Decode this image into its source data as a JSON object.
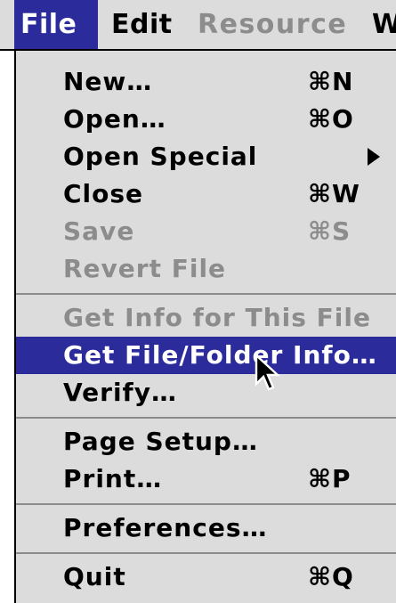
{
  "menubar": {
    "items": [
      {
        "label": "File",
        "state": "active"
      },
      {
        "label": "Edit",
        "state": "enabled"
      },
      {
        "label": "Resource",
        "state": "disabled"
      },
      {
        "label": "W",
        "state": "enabled"
      }
    ]
  },
  "file_menu": {
    "items": [
      {
        "label": "New…",
        "shortcut": "⌘N",
        "state": "enabled"
      },
      {
        "label": "Open…",
        "shortcut": "⌘O",
        "state": "enabled"
      },
      {
        "label": "Open Special",
        "shortcut": "",
        "submenu": true,
        "state": "enabled"
      },
      {
        "label": "Close",
        "shortcut": "⌘W",
        "state": "enabled"
      },
      {
        "label": "Save",
        "shortcut": "⌘S",
        "state": "disabled"
      },
      {
        "label": "Revert File",
        "shortcut": "",
        "state": "disabled"
      },
      {
        "label": "Get Info for This File",
        "shortcut": "",
        "state": "disabled"
      },
      {
        "label": "Get File/Folder Info…",
        "shortcut": "",
        "state": "highlighted"
      },
      {
        "label": "Verify…",
        "shortcut": "",
        "state": "enabled"
      },
      {
        "label": "Page Setup…",
        "shortcut": "",
        "state": "enabled"
      },
      {
        "label": "Print…",
        "shortcut": "⌘P",
        "state": "enabled"
      },
      {
        "label": "Preferences…",
        "shortcut": "",
        "state": "enabled"
      },
      {
        "label": "Quit",
        "shortcut": "⌘Q",
        "state": "enabled"
      }
    ]
  },
  "colors": {
    "menu_background": "#dcdcdc",
    "highlight": "#2b2b9c",
    "disabled_text": "#8c8c8c",
    "separator": "#8c8c8c"
  },
  "icons": {
    "submenu": "submenu-arrow-icon",
    "cursor": "arrow-cursor-icon"
  }
}
